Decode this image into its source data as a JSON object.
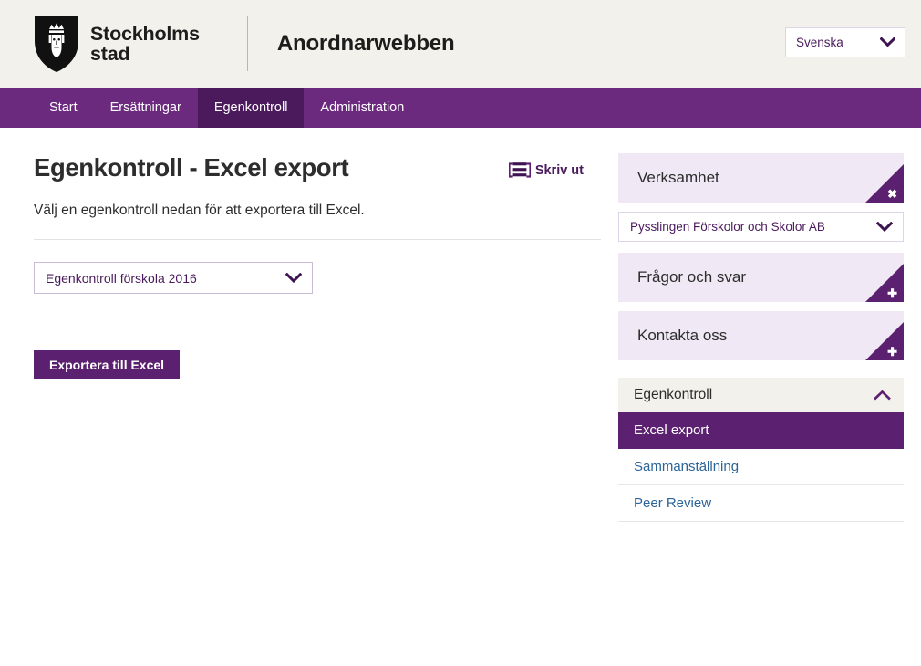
{
  "header": {
    "logo_wordmark": "Stockholms\nstad",
    "logo_icon": "stockholm-shield-logo",
    "app_title": "Anordnarwebben",
    "language_select": {
      "value": "Svenska",
      "icon": "chevron-down-icon"
    }
  },
  "nav": {
    "items": [
      {
        "label": "Start",
        "active": false
      },
      {
        "label": "Ersättningar",
        "active": false
      },
      {
        "label": "Egenkontroll",
        "active": true
      },
      {
        "label": "Administration",
        "active": false
      }
    ]
  },
  "main": {
    "title": "Egenkontroll - Excel export",
    "print_link": {
      "label": "Skriv ut",
      "icon": "printer-icon"
    },
    "intro": "Välj en egenkontroll nedan för att exportera till Excel.",
    "egenkontroll_select": {
      "value": "Egenkontroll förskola 2016",
      "icon": "chevron-down-icon"
    },
    "export_button": "Exportera till Excel"
  },
  "sidebar": {
    "panels": [
      {
        "label": "Verksamhet",
        "corner_glyph": "✖",
        "corner_icon": "close-icon"
      },
      {
        "label": "Frågor och svar",
        "corner_glyph": "✚",
        "corner_icon": "plus-icon"
      },
      {
        "label": "Kontakta oss",
        "corner_glyph": "✚",
        "corner_icon": "plus-icon"
      }
    ],
    "verksamhet_select": {
      "value": "Pysslingen Förskolor och Skolor AB",
      "icon": "chevron-down-icon"
    },
    "section": {
      "title": "Egenkontroll",
      "toggle_icon": "chevron-up-icon",
      "links": [
        {
          "label": "Excel export",
          "active": true
        },
        {
          "label": "Sammanställning",
          "active": false
        },
        {
          "label": "Peer Review",
          "active": false
        }
      ]
    }
  },
  "colors": {
    "brand_purple": "#5c2070",
    "nav_purple": "#6b2a7e",
    "nav_active_purple": "#4a1a5c",
    "header_cream": "#f2f1ec",
    "panel_lavender": "#f0e9f5",
    "link_blue": "#2b6498"
  }
}
